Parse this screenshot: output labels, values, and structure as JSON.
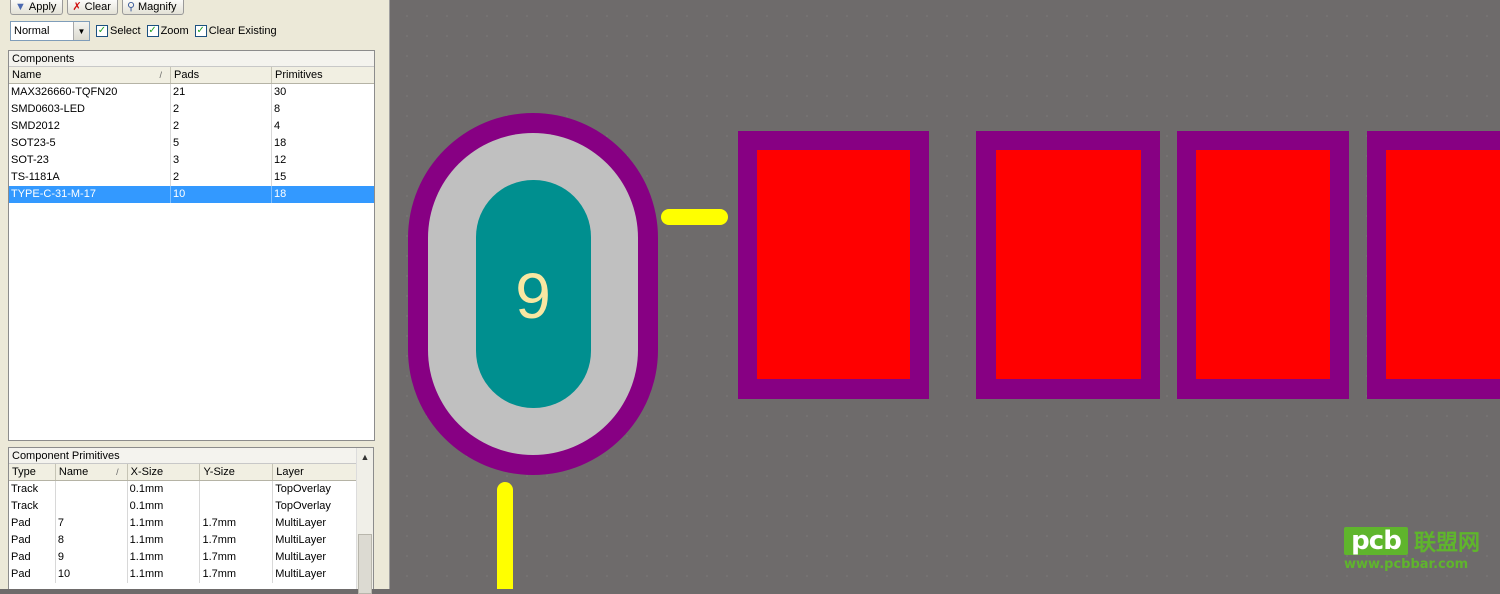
{
  "toolbar": {
    "apply_label": "Apply",
    "clear_label": "Clear",
    "magnify_label": "Magnify"
  },
  "options": {
    "mode_value": "Normal",
    "select_label": "Select",
    "zoom_label": "Zoom",
    "clear_existing_label": "Clear Existing",
    "select_checked": true,
    "zoom_checked": true,
    "clear_existing_checked": true
  },
  "components": {
    "title": "Components",
    "columns": [
      "Name",
      "Pads",
      "Primitives"
    ],
    "rows": [
      [
        "MAX326660-TQFN20",
        "21",
        "30"
      ],
      [
        "SMD0603-LED",
        "2",
        "8"
      ],
      [
        "SMD2012",
        "2",
        "4"
      ],
      [
        "SOT23-5",
        "5",
        "18"
      ],
      [
        "SOT-23",
        "3",
        "12"
      ],
      [
        "TS-1181A",
        "2",
        "15"
      ],
      [
        "TYPE-C-31-M-17",
        "10",
        "18"
      ]
    ],
    "selected_index": 6
  },
  "primitives": {
    "title": "Component Primitives",
    "columns": [
      "Type",
      "Name",
      "X-Size",
      "Y-Size",
      "Layer"
    ],
    "rows": [
      [
        "Track",
        "",
        "0.1mm",
        "",
        "TopOverlay"
      ],
      [
        "Track",
        "",
        "0.1mm",
        "",
        "TopOverlay"
      ],
      [
        "Pad",
        "7",
        "1.1mm",
        "1.7mm",
        "MultiLayer"
      ],
      [
        "Pad",
        "8",
        "1.1mm",
        "1.7mm",
        "MultiLayer"
      ],
      [
        "Pad",
        "9",
        "1.1mm",
        "1.7mm",
        "MultiLayer"
      ],
      [
        "Pad",
        "10",
        "1.1mm",
        "1.7mm",
        "MultiLayer"
      ]
    ]
  },
  "canvas": {
    "pad_designator": "9",
    "colors": {
      "background": "#6e6b6b",
      "solder_mask": "#870083",
      "copper_top": "#ff0000",
      "multilayer_pad": "#c0c0c0",
      "drill_hole": "#008f8f",
      "overlay": "#ffff00",
      "designator_text": "#f8e7a2"
    }
  },
  "watermark": {
    "logo_text": "pcb",
    "cn_text": "联盟网",
    "url_text": "www.pcbbar.com"
  }
}
